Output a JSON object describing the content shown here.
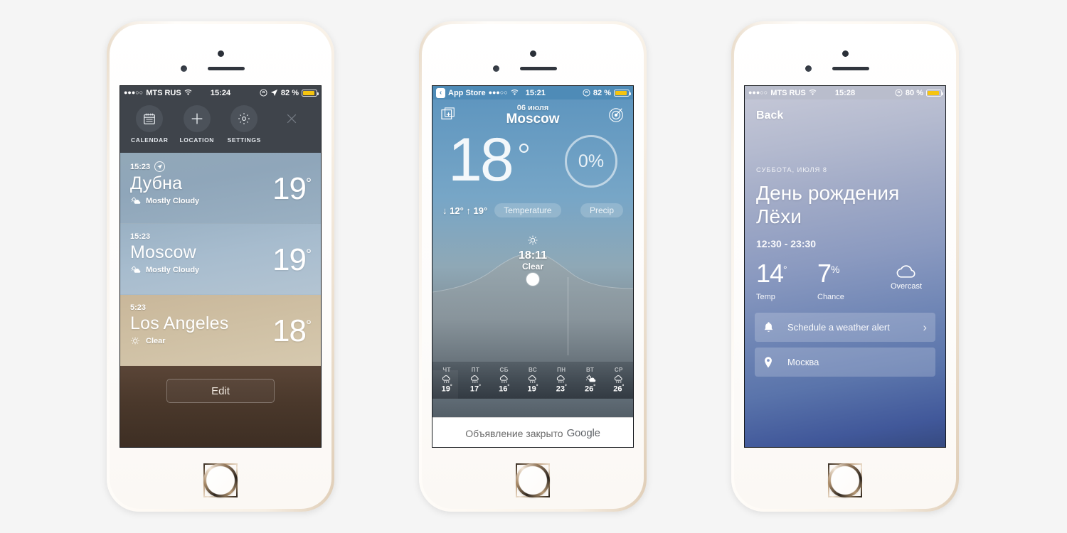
{
  "page": {
    "background": "#f5f5f5"
  },
  "phone1": {
    "status": {
      "dots": "●●●○○",
      "carrier": "MTS RUS",
      "wifi": "wifi-icon",
      "time": "15:24",
      "alarm": "lock-rotation-icon",
      "location": "location-arrow-icon",
      "battery": "82 %"
    },
    "toolbar": [
      {
        "label": "CALENDAR",
        "icon": "calendar-icon"
      },
      {
        "label": "LOCATION",
        "icon": "plus-icon"
      },
      {
        "label": "SETTINGS",
        "icon": "gear-icon"
      }
    ],
    "close_label": "close-icon",
    "cities": [
      {
        "time": "15:23",
        "has_location": true,
        "name": "Дубна",
        "condition": "Mostly Cloudy",
        "icon": "partly-cloudy-icon",
        "temp": "19",
        "deg": "°"
      },
      {
        "time": "15:23",
        "has_location": false,
        "name": "Moscow",
        "condition": "Mostly Cloudy",
        "icon": "partly-cloudy-icon",
        "temp": "19",
        "deg": "°"
      },
      {
        "time": "5:23",
        "has_location": false,
        "name": "Los Angeles",
        "condition": "Clear",
        "icon": "sun-icon",
        "temp": "18",
        "deg": "°"
      }
    ],
    "edit_label": "Edit"
  },
  "phone2": {
    "status": {
      "back_label": "App Store",
      "dots": "●●●○○",
      "wifi": "wifi-icon",
      "time": "15:21",
      "alarm": "lock-rotation-icon",
      "battery": "82 %"
    },
    "nav": {
      "stack_icon": "add-card-icon",
      "target_icon": "target-location-icon"
    },
    "date": "06 июля",
    "city": "Moscow",
    "temp": "18",
    "precip": "0%",
    "low": "↓ 12°",
    "high": "↑ 19°",
    "pill_temperature": "Temperature",
    "pill_precip": "Precip",
    "now": {
      "icon": "sun-icon",
      "time": "18:11",
      "condition": "Clear"
    },
    "forecast": [
      {
        "day": "ЧТ",
        "icon": "rain-icon",
        "temp": "19",
        "deg": "°"
      },
      {
        "day": "ПТ",
        "icon": "rain-icon",
        "temp": "17",
        "deg": "°"
      },
      {
        "day": "СБ",
        "icon": "rain-icon",
        "temp": "16",
        "deg": "°"
      },
      {
        "day": "ВС",
        "icon": "rain-icon",
        "temp": "19",
        "deg": "°"
      },
      {
        "day": "ПН",
        "icon": "rain-icon",
        "temp": "23",
        "deg": "°"
      },
      {
        "day": "ВТ",
        "icon": "partly-cloudy-icon",
        "temp": "26",
        "deg": "°"
      },
      {
        "day": "СР",
        "icon": "rain-icon",
        "temp": "26",
        "deg": "°"
      }
    ],
    "ad": {
      "text": "Объявление закрыто",
      "brand": "Google"
    }
  },
  "phone3": {
    "status": {
      "dots": "●●●○○",
      "carrier": "MTS RUS",
      "wifi": "wifi-icon",
      "time": "15:28",
      "alarm": "lock-rotation-icon",
      "battery": "80 %"
    },
    "back_label": "Back",
    "dateline": "СУББОТА, ИЮЛЯ 8",
    "title": "День рождения Лёхи",
    "hours": "12:30 - 23:30",
    "stats": [
      {
        "value": "14",
        "unit": "°",
        "label": "Temp"
      },
      {
        "value": "7",
        "unit": "%",
        "label": "Chance"
      }
    ],
    "cloud": {
      "icon": "cloud-icon",
      "label": "Overcast"
    },
    "rows": [
      {
        "icon": "bell-icon",
        "label": "Schedule a weather alert",
        "chevron": "›"
      },
      {
        "icon": "map-pin-icon",
        "label": "Москва",
        "chevron": ""
      }
    ]
  },
  "chart_data": {
    "type": "area",
    "title": "Moscow temperature trend",
    "categories": [
      "ЧТ",
      "ПТ",
      "СБ",
      "ВС",
      "ПН",
      "ВТ",
      "СР"
    ],
    "values": [
      19,
      17,
      16,
      19,
      23,
      26,
      26
    ],
    "ylabel": "°C",
    "current_point": {
      "time": "18:11",
      "value": 18,
      "condition": "Clear"
    },
    "legend": "none",
    "grid": false
  }
}
